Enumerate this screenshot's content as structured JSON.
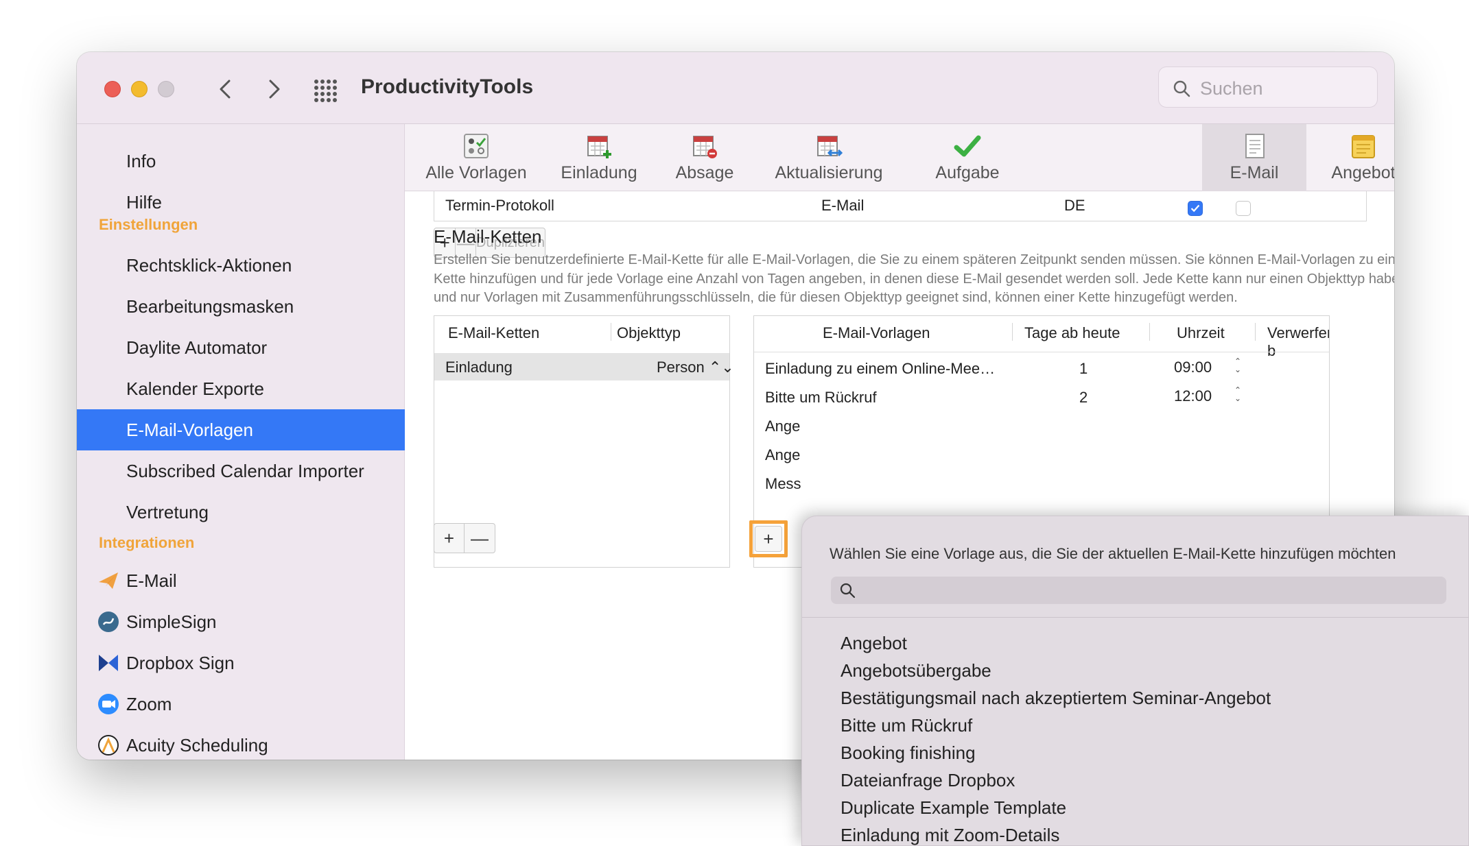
{
  "app": {
    "title": "ProductivityTools"
  },
  "search": {
    "placeholder": "Suchen"
  },
  "sidebar": {
    "items_top": [
      {
        "label": "Info"
      },
      {
        "label": "Hilfe"
      }
    ],
    "section_settings": "Einstellungen",
    "settings_items": [
      {
        "label": "Rechtsklick-Aktionen"
      },
      {
        "label": "Bearbeitungsmasken"
      },
      {
        "label": "Daylite Automator"
      },
      {
        "label": "Kalender Exporte"
      },
      {
        "label": "E-Mail-Vorlagen",
        "selected": true
      },
      {
        "label": "Subscribed Calendar Importer"
      },
      {
        "label": "Vertretung"
      }
    ],
    "section_integrations": "Integrationen",
    "integration_items": [
      {
        "label": "E-Mail",
        "icon": "paper-plane-icon"
      },
      {
        "label": "SimpleSign",
        "icon": "simplesign-icon"
      },
      {
        "label": "Dropbox Sign",
        "icon": "dropbox-sign-icon"
      },
      {
        "label": "Zoom",
        "icon": "zoom-icon"
      },
      {
        "label": "Acuity Scheduling",
        "icon": "acuity-icon"
      }
    ]
  },
  "toolbar": {
    "tabs": [
      {
        "label": "Alle Vorlagen",
        "icon": "all-templates-icon"
      },
      {
        "label": "Einladung",
        "icon": "calendar-add-icon"
      },
      {
        "label": "Absage",
        "icon": "calendar-cancel-icon"
      },
      {
        "label": "Aktualisierung",
        "icon": "calendar-update-icon"
      },
      {
        "label": "Aufgabe",
        "icon": "checkmark-icon"
      },
      {
        "label": "E-Mail",
        "icon": "document-icon",
        "active": true
      },
      {
        "label": "Angebot",
        "icon": "notepad-icon"
      }
    ]
  },
  "templates_table": {
    "visible_row": {
      "name": "Termin-Protokoll",
      "type": "E-Mail",
      "lang": "DE",
      "checked": true,
      "second_checked": false
    },
    "buttons": {
      "add": "+",
      "remove": "—",
      "duplicate": "Duplizieren"
    }
  },
  "chains": {
    "title": "E-Mail-Ketten",
    "description": "Erstellen Sie benutzerdefinierte E-Mail-Kette für alle E-Mail-Vorlagen, die Sie zu einem späteren Zeitpunkt senden müssen. Sie können E-Mail-Vorlagen zu einer Kette hinzufügen und für jede Vorlage eine Anzahl von Tagen angeben, in denen diese E-Mail gesendet werden soll. Jede Kette kann nur einen Objekttyp haben und nur Vorlagen mit Zusammenführungsschlüsseln, die für diesen Objekttyp geeignet sind, können einer Kette hinzugefügt werden.",
    "left_columns": {
      "chain": "E-Mail-Ketten",
      "object_type": "Objekttyp"
    },
    "left_rows": [
      {
        "name": "Einladung",
        "object_type": "Person ⌃⌄"
      }
    ],
    "right_columns": {
      "templates": "E-Mail-Vorlagen",
      "days": "Tage ab heute",
      "time": "Uhrzeit",
      "discard": "Verwerfen b"
    },
    "right_rows": [
      {
        "template": "Einladung zu einem Online-Mee…",
        "days": "1",
        "time": "09:00"
      },
      {
        "template": "Bitte um Rückruf",
        "days": "2",
        "time": "12:00"
      },
      {
        "template": "Ange",
        "days": "",
        "time": ""
      },
      {
        "template": "Ange",
        "days": "",
        "time": ""
      },
      {
        "template": "Mess",
        "days": "",
        "time": ""
      }
    ],
    "buttons": {
      "add": "+",
      "remove": "—",
      "add_template": "+"
    }
  },
  "popover": {
    "title": "Wählen Sie eine Vorlage aus, die Sie der aktuellen E-Mail-Kette hinzufügen möchten",
    "search_value": "",
    "items": [
      "Angebot",
      "Angebotsübergabe",
      "Bestätigungsmail nach akzeptiertem Seminar-Angebot",
      "Bitte um Rückruf",
      "Booking finishing",
      "Dateianfrage Dropbox",
      "Duplicate Example Template",
      "Einladung mit Zoom-Details"
    ]
  },
  "colors": {
    "accent": "#3478f6",
    "section_header": "#f0a43a",
    "highlight": "#f5a23a"
  }
}
